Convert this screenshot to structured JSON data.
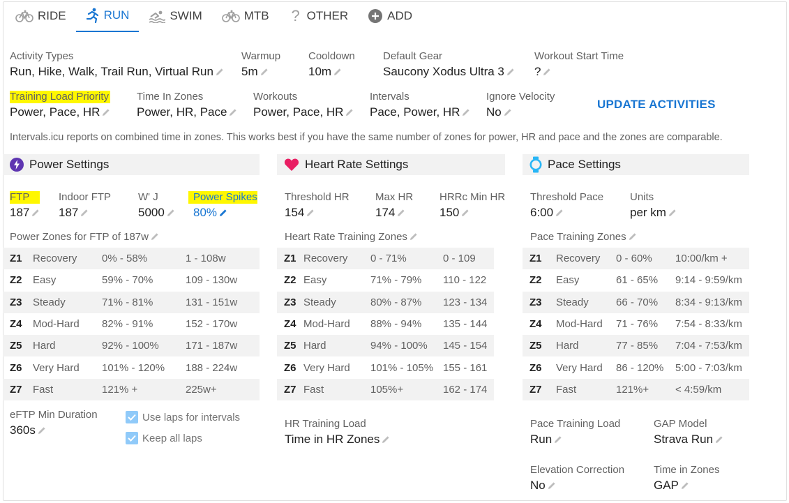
{
  "tabs": [
    {
      "label": "RIDE",
      "icon": "bicycle-icon",
      "active": false
    },
    {
      "label": "RUN",
      "icon": "runner-icon",
      "active": true
    },
    {
      "label": "SWIM",
      "icon": "swimmer-icon",
      "active": false
    },
    {
      "label": "MTB",
      "icon": "bicycle-icon",
      "active": false
    },
    {
      "label": "OTHER",
      "icon": "question-icon",
      "active": false
    },
    {
      "label": "ADD",
      "icon": "plus-circle-icon",
      "active": false
    }
  ],
  "general": {
    "activity_types": {
      "label": "Activity Types",
      "value": "Run, Hike, Walk, Trail Run, Virtual Run"
    },
    "warmup": {
      "label": "Warmup",
      "value": "5m"
    },
    "cooldown": {
      "label": "Cooldown",
      "value": "10m"
    },
    "default_gear": {
      "label": "Default Gear",
      "value": "Saucony Xodus Ultra 3"
    },
    "workout_start_time": {
      "label": "Workout Start Time",
      "value": "?"
    },
    "training_load_priority": {
      "label": "Training Load Priority",
      "value": "Power, Pace, HR"
    },
    "time_in_zones": {
      "label": "Time In Zones",
      "value": "Power, HR, Pace"
    },
    "workouts": {
      "label": "Workouts",
      "value": "Power, Pace, HR"
    },
    "intervals": {
      "label": "Intervals",
      "value": "Pace, Power, HR"
    },
    "ignore_velocity": {
      "label": "Ignore Velocity",
      "value": "No"
    },
    "update_button": "UPDATE ACTIVITIES",
    "note": "Intervals.icu reports on combined time in zones. This works best if you have the same number of zones for power, HR and pace and the zones are comparable."
  },
  "power": {
    "title": "Power Settings",
    "ftp": {
      "label": "FTP",
      "value": "187"
    },
    "indoor_ftp": {
      "label": "Indoor FTP",
      "value": "187"
    },
    "wj": {
      "label": "W' J",
      "value": "5000"
    },
    "power_spikes": {
      "label": "Power Spikes",
      "value": "80%"
    },
    "zones_title": "Power Zones for FTP of 187w",
    "zones": [
      {
        "id": "Z1",
        "name": "Recovery",
        "pct": "0% - 58%",
        "range": "1 - 108w"
      },
      {
        "id": "Z2",
        "name": "Easy",
        "pct": "59% - 70%",
        "range": "109 - 130w"
      },
      {
        "id": "Z3",
        "name": "Steady",
        "pct": "71% - 81%",
        "range": "131 - 151w"
      },
      {
        "id": "Z4",
        "name": "Mod-Hard",
        "pct": "82% - 91%",
        "range": "152 - 170w"
      },
      {
        "id": "Z5",
        "name": "Hard",
        "pct": "92% - 100%",
        "range": "171 - 187w"
      },
      {
        "id": "Z6",
        "name": "Very Hard",
        "pct": "101% - 120%",
        "range": "188 - 224w"
      },
      {
        "id": "Z7",
        "name": "Fast",
        "pct": "121% +",
        "range": "225w+"
      }
    ],
    "eftp": {
      "label": "eFTP Min Duration",
      "value": "360s"
    },
    "use_laps": "Use laps for intervals",
    "keep_laps": "Keep all laps"
  },
  "hr": {
    "title": "Heart Rate Settings",
    "threshold": {
      "label": "Threshold HR",
      "value": "154"
    },
    "max": {
      "label": "Max HR",
      "value": "174"
    },
    "hrrc": {
      "label": "HRRc Min HR",
      "value": "150"
    },
    "zones_title": "Heart Rate Training Zones",
    "zones": [
      {
        "id": "Z1",
        "name": "Recovery",
        "pct": "0 - 71%",
        "range": "0 - 109"
      },
      {
        "id": "Z2",
        "name": "Easy",
        "pct": "71% - 79%",
        "range": "110 - 122"
      },
      {
        "id": "Z3",
        "name": "Steady",
        "pct": "80% - 87%",
        "range": "123 - 134"
      },
      {
        "id": "Z4",
        "name": "Mod-Hard",
        "pct": "88% - 94%",
        "range": "135 - 144"
      },
      {
        "id": "Z5",
        "name": "Hard",
        "pct": "94% - 100%",
        "range": "145 - 154"
      },
      {
        "id": "Z6",
        "name": "Very Hard",
        "pct": "101% - 105%",
        "range": "155 - 161"
      },
      {
        "id": "Z7",
        "name": "Fast",
        "pct": "105%+",
        "range": "162 - 174"
      }
    ],
    "load": {
      "label": "HR Training Load",
      "value": "Time in HR Zones"
    }
  },
  "pace": {
    "title": "Pace Settings",
    "threshold": {
      "label": "Threshold Pace",
      "value": "6:00"
    },
    "units": {
      "label": "Units",
      "value": "per km"
    },
    "zones_title": "Pace Training Zones",
    "zones": [
      {
        "id": "Z1",
        "name": "Recovery",
        "pct": "0 - 60%",
        "range": "10:00/km +"
      },
      {
        "id": "Z2",
        "name": "Easy",
        "pct": "61 - 65%",
        "range": "9:14 - 9:59/km"
      },
      {
        "id": "Z3",
        "name": "Steady",
        "pct": "66 - 70%",
        "range": "8:34 - 9:13/km"
      },
      {
        "id": "Z4",
        "name": "Mod-Hard",
        "pct": "71 - 76%",
        "range": "7:54 - 8:33/km"
      },
      {
        "id": "Z5",
        "name": "Hard",
        "pct": "77 - 85%",
        "range": "7:04 - 7:53/km"
      },
      {
        "id": "Z6",
        "name": "Very Hard",
        "pct": "86 - 120%",
        "range": "5:00 - 7:03/km"
      },
      {
        "id": "Z7",
        "name": "Fast",
        "pct": "121%+",
        "range": "< 4:59/km"
      }
    ],
    "load": {
      "label": "Pace Training Load",
      "value": "Run"
    },
    "gap": {
      "label": "GAP Model",
      "value": "Strava Run"
    },
    "elevation": {
      "label": "Elevation Correction",
      "value": "No"
    },
    "tiz": {
      "label": "Time in Zones",
      "value": "GAP"
    }
  },
  "colors": {
    "accent": "#1976d2",
    "highlight": "#fff700",
    "heart": "#e91e63",
    "power_icon": "#5e35b1",
    "pace_icon": "#29b6f6"
  }
}
